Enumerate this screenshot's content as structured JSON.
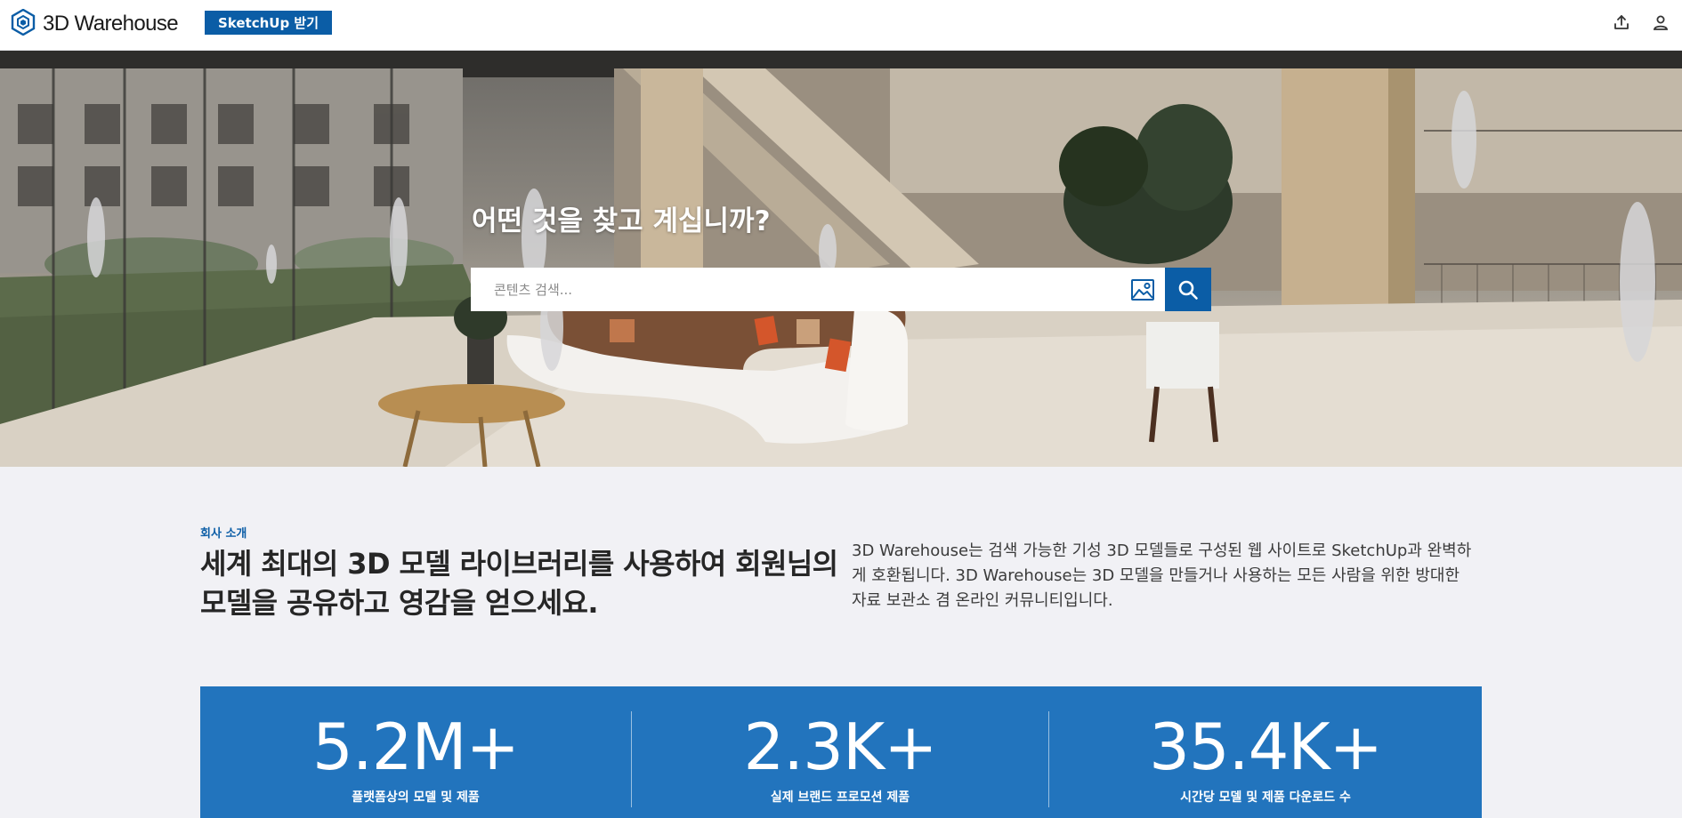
{
  "header": {
    "logo_text": "3D Warehouse",
    "logo_icon": "warehouse-cube-icon",
    "get_sketchup_label": "SketchUp 받기",
    "upload_icon": "upload-icon",
    "account_icon": "user-icon"
  },
  "hero": {
    "title": "어떤 것을 찾고 계십니까?",
    "search_placeholder": "콘텐츠 검색...",
    "image_search_icon": "image-search-icon",
    "search_icon": "search-icon"
  },
  "about": {
    "eyebrow": "회사 소개",
    "headline": "세계 최대의 3D 모델 라이브러리를 사용하여 회원님의 모델을 공유하고 영감을 얻으세요.",
    "body": "3D Warehouse는 검색 가능한 기성 3D 모델들로 구성된 웹 사이트로 SketchUp과 완벽하게 호환됩니다. 3D Warehouse는 3D 모델을 만들거나 사용하는 모든 사람을 위한 방대한 자료 보관소 겸 온라인 커뮤니티입니다."
  },
  "stats": [
    {
      "value": "5.2M+",
      "label": "플랫폼상의 모델 및 제품"
    },
    {
      "value": "2.3K+",
      "label": "실제 브랜드 프로모션 제품"
    },
    {
      "value": "35.4K+",
      "label": "시간당 모델 및 제품 다운로드 수"
    }
  ],
  "colors": {
    "brand_blue": "#0b5da6",
    "stats_blue": "#2274bd",
    "page_background": "#f1f1f5"
  }
}
